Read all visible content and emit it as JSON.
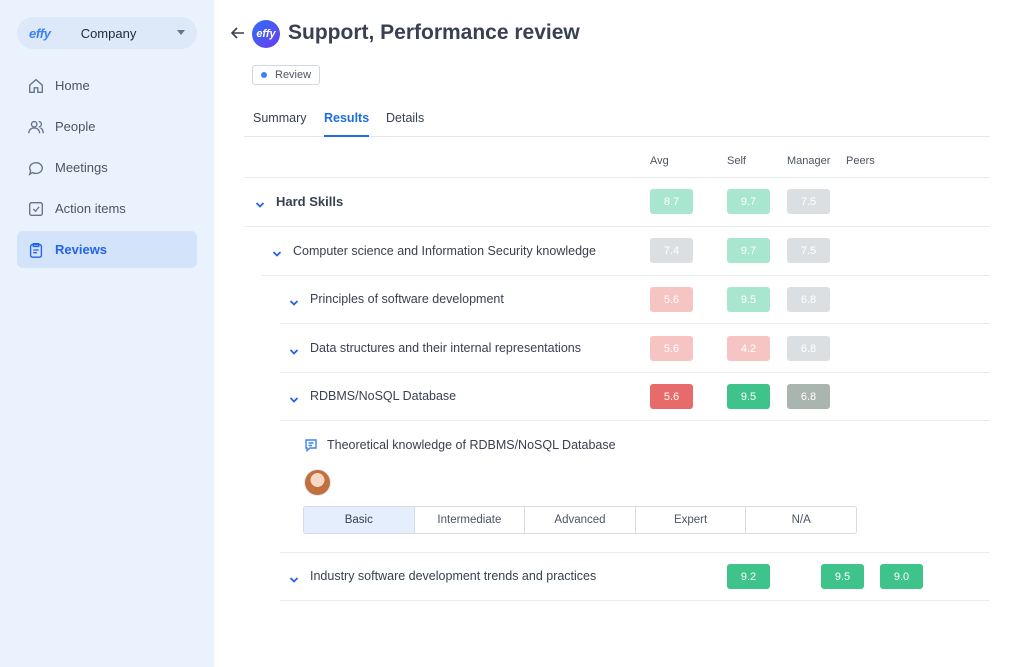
{
  "sidebar": {
    "brand": "effy",
    "company": "Company",
    "items": [
      {
        "label": "Home",
        "icon": "home-icon"
      },
      {
        "label": "People",
        "icon": "people-icon"
      },
      {
        "label": "Meetings",
        "icon": "chat-icon"
      },
      {
        "label": "Action items",
        "icon": "checkbox-icon"
      },
      {
        "label": "Reviews",
        "icon": "clipboard-icon",
        "active": true
      }
    ]
  },
  "header": {
    "logo_text": "effy",
    "title": "Support, Performance review",
    "status": "Review"
  },
  "tabs": [
    "Summary",
    "Results",
    "Details"
  ],
  "active_tab": "Results",
  "columns": [
    "Avg",
    "Self",
    "Manager",
    "Peers"
  ],
  "rows": {
    "hard_skills": {
      "label": "Hard Skills",
      "avg": "8.7",
      "self": "9.7",
      "manager": "7.5"
    },
    "cs_knowledge": {
      "label": "Computer science and Information Security knowledge",
      "avg": "7.4",
      "self": "9.7",
      "manager": "7.5"
    },
    "principles": {
      "label": "Principles of software development",
      "avg": "5.6",
      "self": "9.5",
      "manager": "6.8"
    },
    "data_structures": {
      "label": "Data structures and their internal representations",
      "avg": "5.6",
      "self": "4.2",
      "manager": "6.8"
    },
    "rdbms": {
      "label": "RDBMS/NoSQL Database",
      "avg": "5.6",
      "self": "9.5",
      "manager": "6.8"
    },
    "industry": {
      "label": "Industry software development trends and practices",
      "self": "9.2",
      "manager": "9.5",
      "peers": "9.0"
    }
  },
  "comment": {
    "question": "Theoretical knowledge of RDBMS/NoSQL Database",
    "levels": [
      "Basic",
      "Intermediate",
      "Advanced",
      "Expert",
      "N/A"
    ],
    "selected": "Basic"
  },
  "colors": {
    "accent": "#1d6fe0",
    "green_light": "#a8e6cf",
    "green": "#3ec48a",
    "red_light": "#f7c4c4",
    "red": "#e86b6b",
    "gray_light": "#dcdfe1",
    "gray": "#a9b5ae"
  }
}
